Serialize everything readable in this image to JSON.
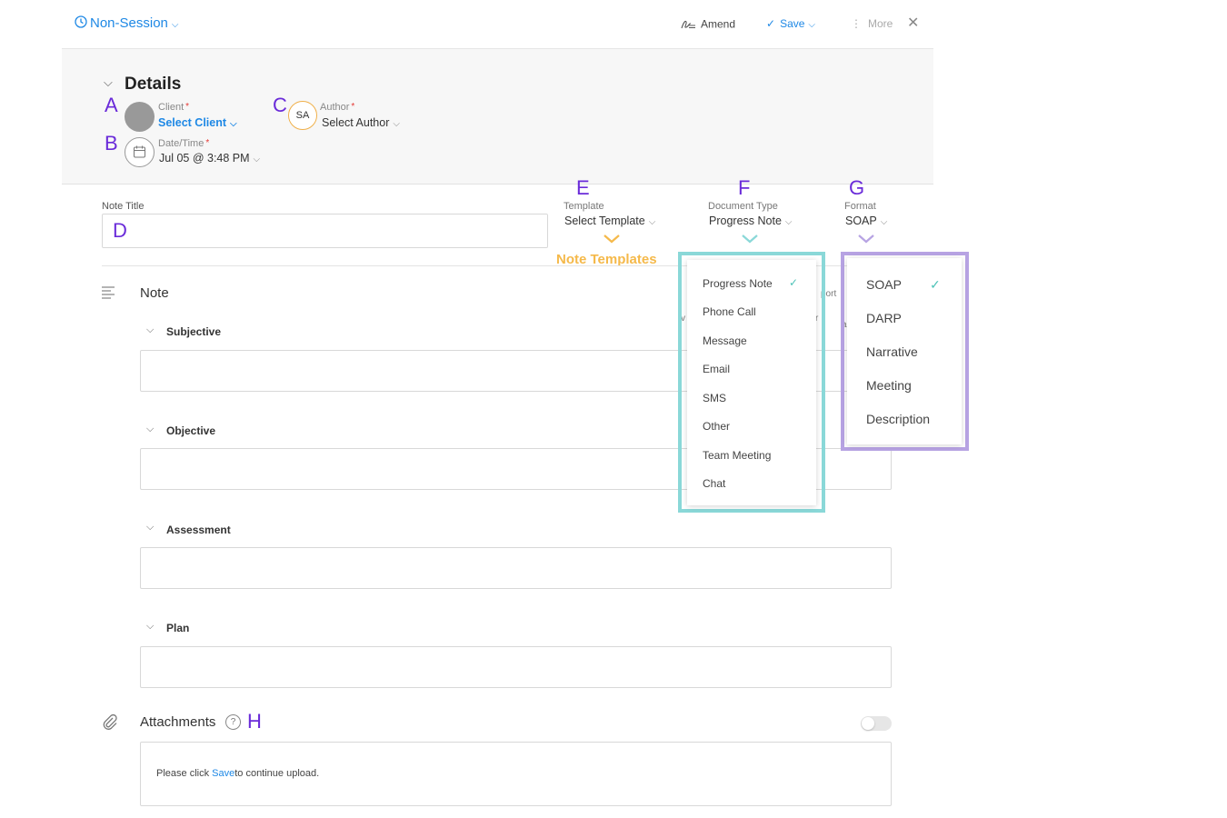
{
  "header": {
    "session_type": "Non-Session",
    "amend_label": "Amend",
    "save_label": "Save",
    "more_label": "More",
    "close_symbol": "✕"
  },
  "details": {
    "title": "Details",
    "client_label": "Client",
    "client_value": "Select Client",
    "author_label": "Author",
    "author_initials": "SA",
    "author_value": "Select Author",
    "datetime_label": "Date/Time",
    "datetime_value": "Jul 05 @ 3:48 PM",
    "required_mark": "*"
  },
  "note_title": {
    "label": "Note Title",
    "value": ""
  },
  "template": {
    "label": "Template",
    "value": "Select Template",
    "annotation": "Note Templates"
  },
  "document_type": {
    "label": "Document Type",
    "value": "Progress Note",
    "options": [
      "Progress Note",
      "Phone Call",
      "Message",
      "Email",
      "SMS",
      "Other",
      "Team Meeting",
      "Chat"
    ],
    "selected": "Progress Note"
  },
  "format": {
    "label": "Format",
    "value": "SOAP",
    "options": [
      "SOAP",
      "DARP",
      "Narrative",
      "Meeting",
      "Description"
    ],
    "selected": "SOAP"
  },
  "note": {
    "label": "Note",
    "sections": [
      {
        "title": "Subjective",
        "value": ""
      },
      {
        "title": "Objective",
        "value": ""
      },
      {
        "title": "Assessment",
        "value": ""
      },
      {
        "title": "Plan",
        "value": ""
      }
    ]
  },
  "attachments": {
    "label": "Attachments",
    "message_prefix": "Please click",
    "message_link": "Save",
    "message_suffix": "to continue upload."
  },
  "hidden_fragments": {
    "a": "port",
    "b": "r",
    "c": "a",
    "d": "v"
  },
  "annotations": {
    "A": "A",
    "B": "B",
    "C": "C",
    "D": "D",
    "E": "E",
    "F": "F",
    "G": "G",
    "H": "H"
  },
  "colors": {
    "link_blue": "#1e88e5",
    "marker_purple": "#6a2bd9",
    "teal_highlight": "#8ad8d8",
    "lavender_highlight": "#b7a3e3",
    "orange_annotation": "#f5b94a",
    "check_teal": "#4fc3b8"
  },
  "icons": {
    "clock": "clock-icon",
    "signature": "signature-icon",
    "check": "check-icon",
    "more": "more-vertical-icon",
    "close": "close-icon",
    "calendar": "calendar-icon",
    "note": "note-lines-icon",
    "paperclip": "paperclip-icon",
    "help": "help-circle-icon",
    "toggle": "toggle-off"
  }
}
